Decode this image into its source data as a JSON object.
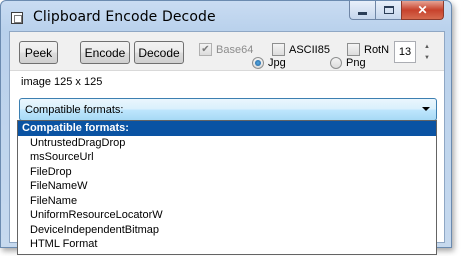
{
  "window": {
    "title": "Clipboard Encode Decode",
    "caption": {
      "minimize": "",
      "maximize": "",
      "close": "✕"
    }
  },
  "toolbar": {
    "peek_label": "Peek",
    "encode_label": "Encode",
    "decode_label": "Decode",
    "base64_label": "Base64",
    "base64_checked": true,
    "base64_disabled": true,
    "ascii85_label": "ASCII85",
    "ascii85_checked": false,
    "rotn_label": "RotN",
    "rotn_checked": false,
    "rotn_value": "13",
    "format_options": [
      {
        "label": "Jpg",
        "selected": true
      },
      {
        "label": "Png",
        "selected": false
      }
    ]
  },
  "info_text": "image 125 x 125",
  "combo": {
    "selected": "Compatible formats:",
    "options": [
      "Compatible formats:",
      "UntrustedDragDrop",
      "msSourceUrl",
      "FileDrop",
      "FileNameW",
      "FileName",
      "UniformResourceLocatorW",
      "DeviceIndependentBitmap",
      "HTML Format"
    ]
  }
}
